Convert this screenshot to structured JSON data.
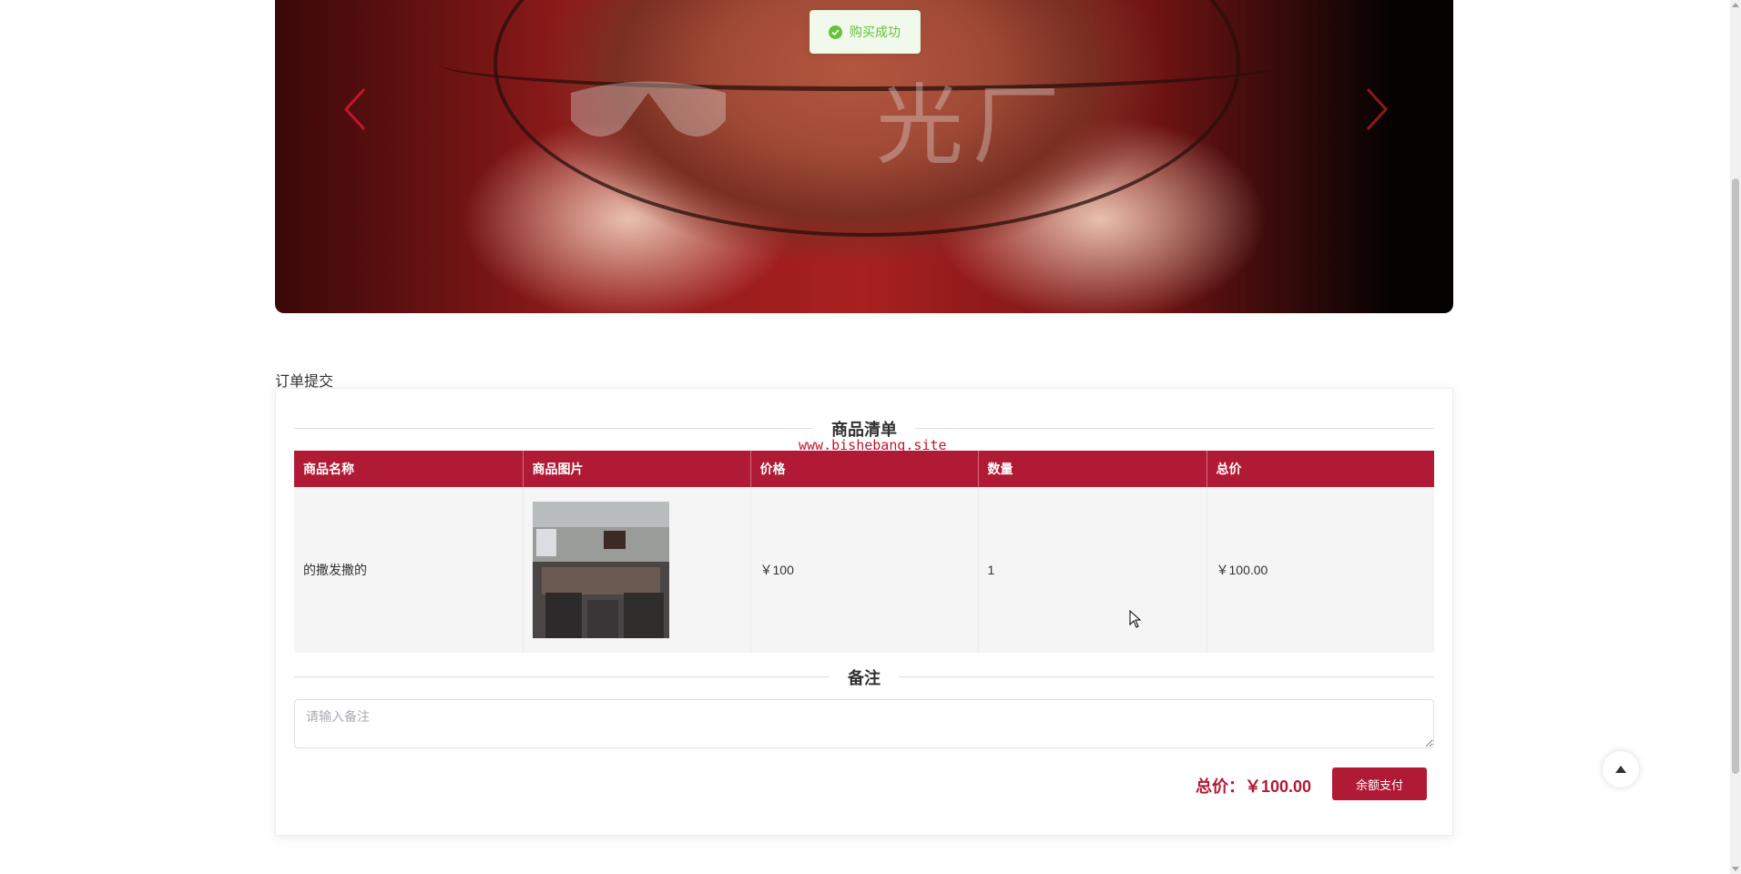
{
  "banner": {
    "watermark_text": "光厂"
  },
  "toast": {
    "message": "购买成功",
    "color": "#67c23a"
  },
  "order": {
    "section_title": "订单提交",
    "goods_list_heading": "商品清单",
    "site_stamp": "www.bishebang.site",
    "columns": [
      "商品名称",
      "商品图片",
      "价格",
      "数量",
      "总价"
    ],
    "rows": [
      {
        "name": "的撒发撒的",
        "image": "conference-room-photo",
        "price": "￥100",
        "quantity": "1",
        "subtotal": "￥100.00"
      }
    ],
    "remark_heading": "备注",
    "remark_placeholder": "请输入备注",
    "total_label": "总价：￥100.00",
    "pay_button_label": "余额支付"
  },
  "colors": {
    "accent": "#b01a35",
    "success": "#67c23a"
  },
  "icons": {
    "carousel_prev": "chevron-left-icon",
    "carousel_next": "chevron-right-icon",
    "back_to_top": "caret-up-icon",
    "toast": "check-circle-icon"
  }
}
